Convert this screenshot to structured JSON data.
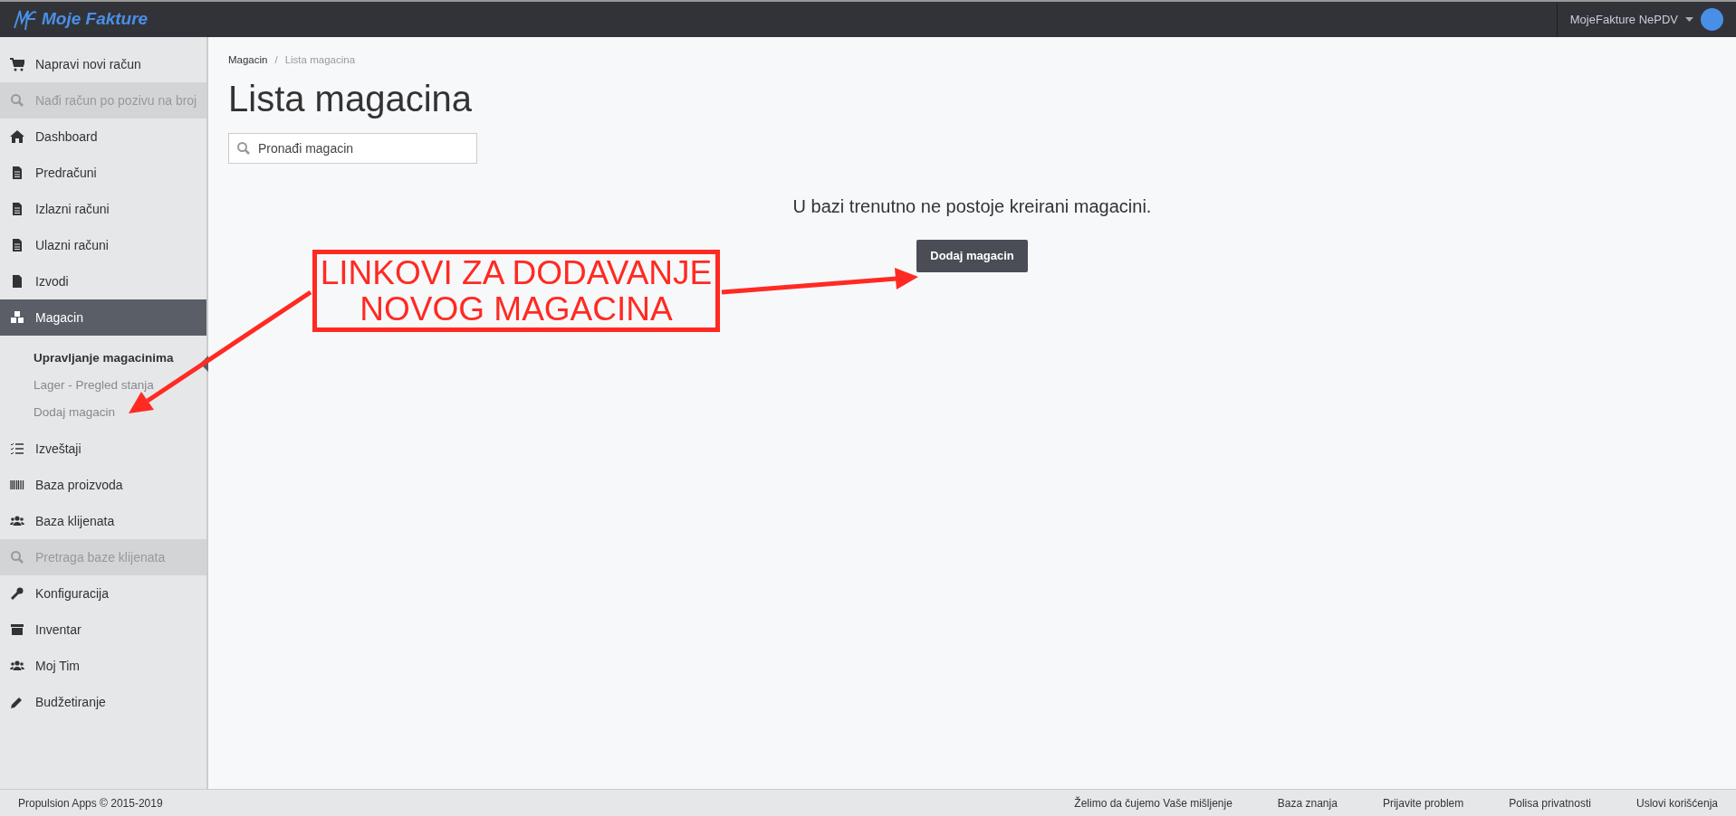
{
  "header": {
    "logo_text": "Moje Fakture",
    "user": "MojeFakture NePDV"
  },
  "sidebar": {
    "items": [
      {
        "kind": "link",
        "label": "Napravi novi račun",
        "selected": false
      },
      {
        "kind": "search",
        "label": "Nađi račun po pozivu na broj",
        "selected": false
      },
      {
        "kind": "link",
        "label": "Dashboard",
        "selected": false
      },
      {
        "kind": "link",
        "label": "Predračuni",
        "selected": false
      },
      {
        "kind": "link",
        "label": "Izlazni računi",
        "selected": false
      },
      {
        "kind": "link",
        "label": "Ulazni računi",
        "selected": false
      },
      {
        "kind": "link",
        "label": "Izvodi",
        "selected": false
      },
      {
        "kind": "link",
        "label": "Magacin",
        "selected": true,
        "children": [
          {
            "label": "Upravljanje magacinima",
            "selected": true
          },
          {
            "label": "Lager - Pregled stanja",
            "selected": false
          },
          {
            "label": "Dodaj magacin",
            "selected": false
          }
        ]
      },
      {
        "kind": "link",
        "label": "Izveštaji",
        "selected": false
      },
      {
        "kind": "link",
        "label": "Baza proizvoda",
        "selected": false
      },
      {
        "kind": "link",
        "label": "Baza klijenata",
        "selected": false
      },
      {
        "kind": "search",
        "label": "Pretraga baze klijenata",
        "selected": false
      },
      {
        "kind": "link",
        "label": "Konfiguracija",
        "selected": false
      },
      {
        "kind": "link",
        "label": "Inventar",
        "selected": false
      },
      {
        "kind": "link",
        "label": "Moj Tim",
        "selected": false
      },
      {
        "kind": "link",
        "label": "Budžetiranje",
        "selected": false
      }
    ]
  },
  "breadcrumb_separator": "/",
  "breadcrumb": [
    {
      "label": "Magacin",
      "active": false
    },
    {
      "label": "Lista magacina",
      "active": true
    }
  ],
  "title": "Lista magacina",
  "search": {
    "placeholder": "Pronađi magacin"
  },
  "empty_message": "U bazi trenutno ne postoje kreirani magacini.",
  "add_button": "Dodaj magacin",
  "annotation": {
    "text": "LINKOVI ZA DODAVANJE NOVOG MAGACINA"
  },
  "footer": {
    "copyright": "Propulsion Apps © 2015-2019",
    "links": [
      "Želimo da čujemo Vaše mišljenje",
      "Baza znanja",
      "Prijavite problem",
      "Polisa privatnosti",
      "Uslovi korišćenja"
    ]
  }
}
